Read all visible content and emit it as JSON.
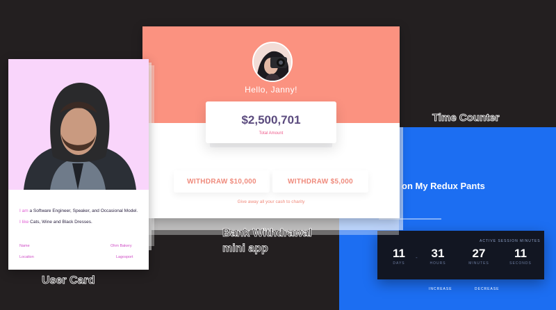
{
  "timer_counter": {
    "title": "Time Counter",
    "heading": "on My Redux Pants",
    "card_label": "ACTIVE SESSION MINUTES",
    "units": [
      {
        "value": "11",
        "label": "DAYS"
      },
      {
        "value": "31",
        "label": "HOURS"
      },
      {
        "value": "27",
        "label": "MINUTES"
      },
      {
        "value": "11",
        "label": "SECONDS"
      }
    ],
    "separator": "-",
    "increase_label": "INCREASE",
    "decrease_label": "DECREASE",
    "accent_color": "#1c6ef2"
  },
  "bank_app": {
    "greeting": "Hello, Janny!",
    "amount": "$2,500,701",
    "amount_label": "Total Amount",
    "withdraw_buttons": [
      "WITHDRAW $10,000",
      "WITHDRAW $5,000"
    ],
    "charity_text": "Give away all your cash to charity",
    "caption_line1": "Bank Withdrawal",
    "caption_line2": "mini app",
    "accent_color": "#fb9280"
  },
  "user_card": {
    "bio_line1_prefix": "I am",
    "bio_line1_rest": " a Software Engineer, Speaker, and Occasional Model.",
    "bio_line2_prefix": "I like",
    "bio_line2_rest": " Cats, Wine and Black Dresses.",
    "name_label": "Name",
    "name_value": "Ohm Bakery",
    "location_label": "Location",
    "location_value": "Lagosport",
    "caption": "User Card",
    "accent_color": "#f9d5fb"
  }
}
